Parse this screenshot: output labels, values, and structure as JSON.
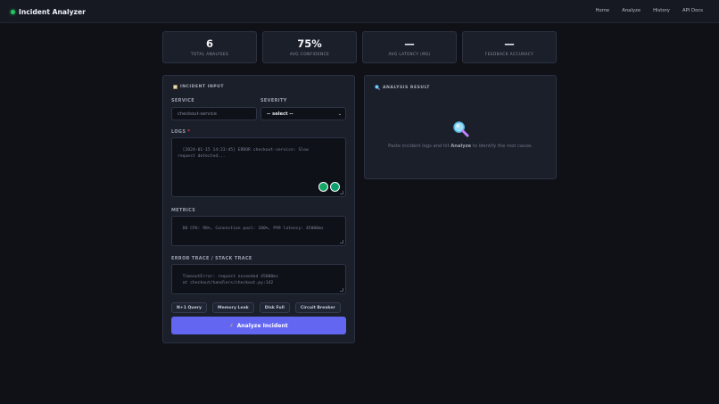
{
  "app": {
    "title": "Incident Analyzer"
  },
  "nav": {
    "items": [
      "Home",
      "Analyze",
      "History",
      "API Docs"
    ]
  },
  "stats": [
    {
      "value": "6",
      "label": "TOTAL ANALYSES"
    },
    {
      "value": "75%",
      "label": "AVG CONFIDENCE"
    },
    {
      "value": "—",
      "label": "AVG LATENCY (MS)"
    },
    {
      "value": "—",
      "label": "FEEDBACK ACCURACY"
    }
  ],
  "input_panel": {
    "title": "INCIDENT INPUT",
    "service_label": "SERVICE",
    "service_placeholder": "checkout-service",
    "severity_label": "SEVERITY",
    "severity_selected": "-- select --",
    "logs_label": "LOGS",
    "logs_required": "*",
    "logs_placeholder": "[2024-01-15 14:23:45] ERROR checkout-service: Slow\nrequest detected...",
    "metrics_label": "METRICS",
    "metrics_placeholder": "DB CPU: 98%, Connection pool: 100%, P99 latency: 45000ms",
    "trace_label": "ERROR TRACE / STACK TRACE",
    "trace_placeholder": "TimeoutError: request exceeded 45000ms\n  at checkout/handlers/checkout.py:142",
    "presets": [
      "N+1 Query",
      "Memory Leak",
      "Disk Full",
      "Circuit Breaker"
    ],
    "analyze_button": "Analyze Incident"
  },
  "result_panel": {
    "title": "ANALYSIS RESULT",
    "empty_prefix": "Paste incident logs and hit ",
    "empty_action": "Analyze",
    "empty_suffix": " to identify the root cause."
  },
  "colors": {
    "accent": "#6366f1",
    "background": "#0f1117",
    "panel": "#1b1f2a",
    "status_dot": "#22c55e",
    "required": "#ef4444"
  },
  "icons": {
    "brand": "status-dot-icon",
    "input_panel": "clipboard-icon",
    "result_panel": "magnifier-icon",
    "empty_state": "magnifier-icon",
    "analyze": "lightning-icon"
  }
}
